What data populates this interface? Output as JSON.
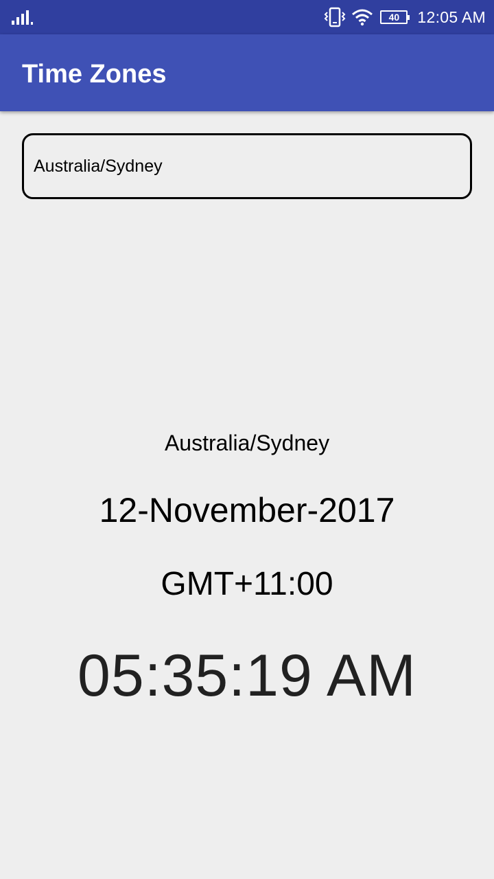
{
  "status_bar": {
    "signal_icon": "cell-signal-icon",
    "vibrate_icon": "vibrate-icon",
    "wifi_icon": "wifi-icon",
    "battery_level": "40",
    "clock": "12:05 AM"
  },
  "app_bar": {
    "title": "Time Zones"
  },
  "timezone_input": {
    "value": "Australia/Sydney"
  },
  "display": {
    "zone": "Australia/Sydney",
    "date": "12-November-2017",
    "gmt_offset": "GMT+11:00",
    "time": "05:35:19 AM"
  },
  "colors": {
    "status_bar": "#303f9f",
    "app_bar": "#3f51b5",
    "background": "#eeeeee",
    "text": "#000000"
  }
}
